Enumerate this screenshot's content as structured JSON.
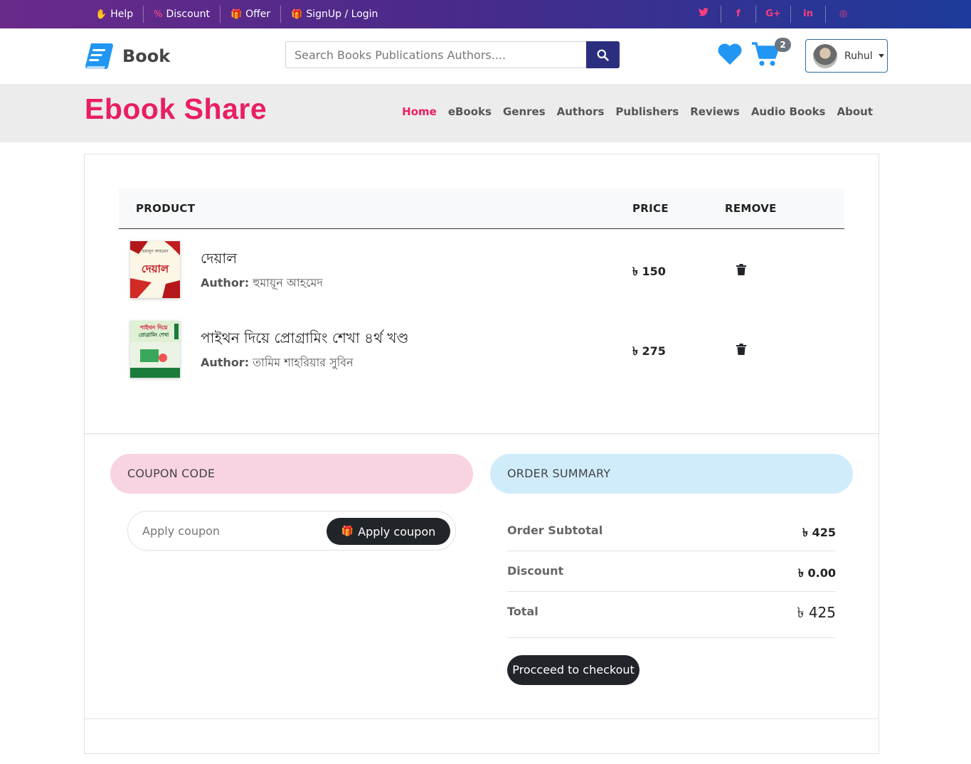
{
  "topbar": {
    "links": [
      {
        "icon": "help-hand-icon",
        "label": "Help"
      },
      {
        "icon": "percent-icon",
        "label": "Discount"
      },
      {
        "icon": "gift-icon",
        "label": "Offer"
      },
      {
        "icon": "gift-icon",
        "label": "SignUp / Login"
      }
    ],
    "social": [
      {
        "icon": "twitter-icon",
        "glyph": "🐦"
      },
      {
        "icon": "facebook-icon",
        "glyph": "f"
      },
      {
        "icon": "google-plus-icon",
        "glyph": "G+"
      },
      {
        "icon": "linkedin-icon",
        "glyph": "in"
      },
      {
        "icon": "instagram-icon",
        "glyph": "◎"
      }
    ]
  },
  "header": {
    "logo_text": "Book",
    "search_placeholder": "Search Books Publications Authors....",
    "cart_count": "2",
    "user_name": "Ruhul"
  },
  "brand": {
    "title": "Ebook Share",
    "nav": [
      "Home",
      "eBooks",
      "Genres",
      "Authors",
      "Publishers",
      "Reviews",
      "Audio Books",
      "About"
    ],
    "active": "Home"
  },
  "cart": {
    "columns": {
      "product": "PRODUCT",
      "price": "PRICE",
      "remove": "REMOVE"
    },
    "items": [
      {
        "title": "দেয়াল",
        "author_label": "Author:",
        "author": "হুমায়ূন আহমেদ",
        "price": "৳ 150"
      },
      {
        "title": "পাইথন দিয়ে প্রোগ্রামিং শেখা ৪র্থ খণ্ড",
        "author_label": "Author:",
        "author": "তামিম শাহরিয়ার সুবিন",
        "price": "৳ 275"
      }
    ]
  },
  "coupon": {
    "heading": "COUPON CODE",
    "placeholder": "Apply coupon",
    "button": "Apply coupon"
  },
  "summary": {
    "heading": "ORDER SUMMARY",
    "rows": [
      {
        "label": "Order Subtotal",
        "value": "৳ 425"
      },
      {
        "label": "Discount",
        "value": "৳ 0.00"
      },
      {
        "label": "Total",
        "value": "৳ 425"
      }
    ],
    "checkout": "Procceed to checkout"
  },
  "colors": {
    "brand": "#e91e63",
    "accent": "#2b2e7e",
    "heart": "#2196f3"
  }
}
